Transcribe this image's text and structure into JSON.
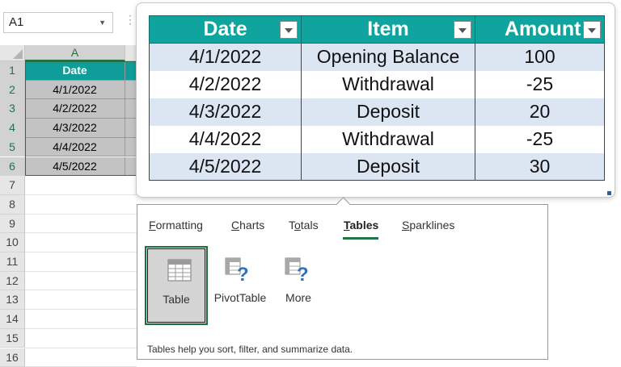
{
  "namebox": {
    "value": "A1"
  },
  "sheet": {
    "col_headers": [
      "A"
    ],
    "row_numbers": [
      "1",
      "2",
      "3",
      "4",
      "5",
      "6",
      "7",
      "8",
      "9",
      "10",
      "11",
      "12",
      "13",
      "14",
      "15",
      "16"
    ],
    "header_cell": "Date",
    "date_cells": [
      "4/1/2022",
      "4/2/2022",
      "4/3/2022",
      "4/4/2022",
      "4/5/2022"
    ]
  },
  "preview": {
    "headers": [
      "Date",
      "Item",
      "Amount"
    ],
    "rows": [
      [
        "4/1/2022",
        "Opening Balance",
        "100"
      ],
      [
        "4/2/2022",
        "Withdrawal",
        "-25"
      ],
      [
        "4/3/2022",
        "Deposit",
        "20"
      ],
      [
        "4/4/2022",
        "Withdrawal",
        "-25"
      ],
      [
        "4/5/2022",
        "Deposit",
        "30"
      ]
    ]
  },
  "quick_analysis": {
    "tabs": [
      {
        "first": "F",
        "rest": "ormatting"
      },
      {
        "first": "C",
        "rest": "harts"
      },
      {
        "pre": "T",
        "first": "o",
        "rest": "tals"
      },
      {
        "first": "T",
        "rest": "ables"
      },
      {
        "first": "S",
        "rest": "parklines"
      }
    ],
    "tiles": [
      "Table",
      "PivotTable",
      "More"
    ],
    "description": "Tables help you sort, filter, and summarize data."
  },
  "colors": {
    "accent": "#217346",
    "table_header": "#0fa49e",
    "band": "#dbe6f2"
  },
  "icons": [
    "chevron-down-icon",
    "table-icon",
    "pivottable-icon",
    "more-icon",
    "filter-dropdown-icon"
  ]
}
